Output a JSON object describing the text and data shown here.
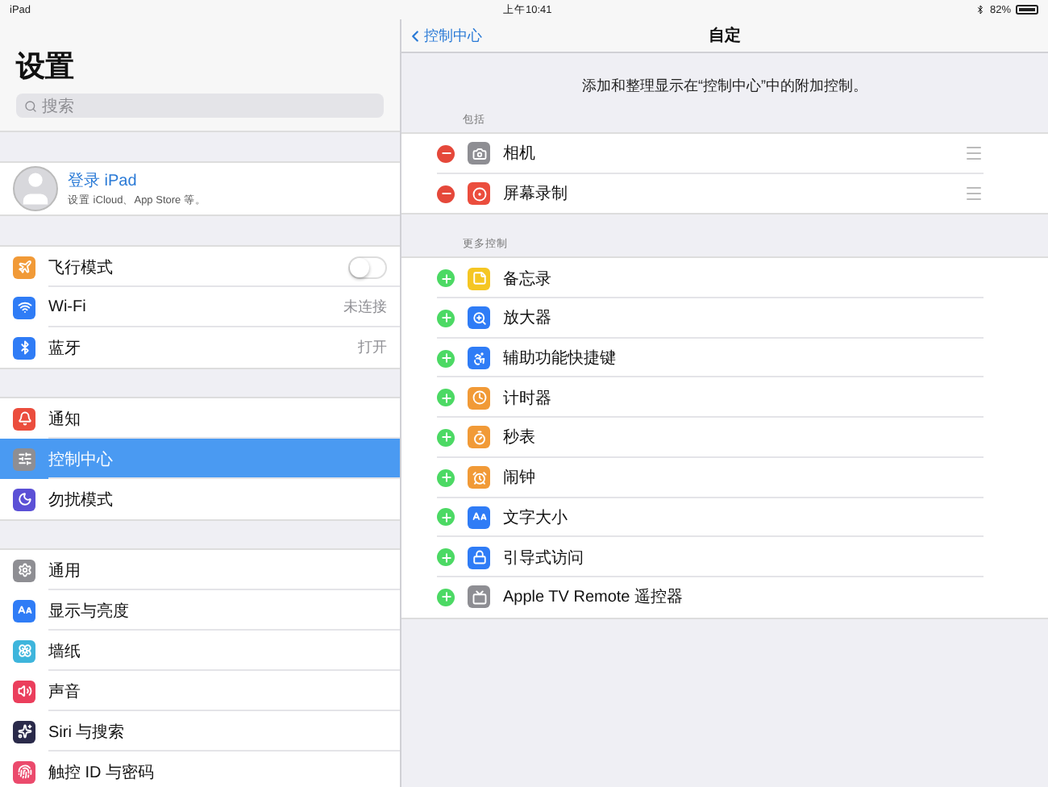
{
  "status_bar": {
    "device": "iPad",
    "time": "上午10:41",
    "battery": "82%"
  },
  "sidebar": {
    "title": "设置",
    "search": {
      "placeholder": "搜索"
    },
    "account": {
      "name": "登录 iPad",
      "subtitle": "设置 iCloud、App Store 等。"
    },
    "groups": [
      {
        "items": [
          {
            "label": "飞行模式",
            "kind": "toggle",
            "on": false,
            "color": "#f19a37",
            "selected": false
          },
          {
            "label": "Wi-Fi",
            "kind": "value",
            "value": "未连接",
            "color": "#2f7cf6",
            "selected": false
          },
          {
            "label": "蓝牙",
            "kind": "value",
            "value": "打开",
            "color": "#2f7cf6",
            "selected": false
          }
        ]
      },
      {
        "items": [
          {
            "label": "通知",
            "kind": "plain",
            "color": "#eb4d3d",
            "selected": false
          },
          {
            "label": "控制中心",
            "kind": "plain",
            "color": "#8e8e93",
            "selected": true
          },
          {
            "label": "勿扰模式",
            "kind": "plain",
            "color": "#5b50d6",
            "selected": false
          }
        ]
      },
      {
        "items": [
          {
            "label": "通用",
            "kind": "plain",
            "color": "#8e8e93",
            "selected": false
          },
          {
            "label": "显示与亮度",
            "kind": "plain",
            "color": "#2f7cf6",
            "selected": false
          },
          {
            "label": "墙纸",
            "kind": "plain",
            "color": "#3eb5dc",
            "selected": false
          },
          {
            "label": "声音",
            "kind": "plain",
            "color": "#eb3e5c",
            "selected": false
          },
          {
            "label": "Siri 与搜索",
            "kind": "plain",
            "color": "#2a2a4a",
            "selected": false
          },
          {
            "label": "触控 ID 与密码",
            "kind": "plain",
            "color": "#eb4a6c",
            "selected": false
          }
        ]
      }
    ]
  },
  "detail": {
    "back": "控制中心",
    "title": "自定",
    "description": "添加和整理显示在“控制中心”中的附加控制。",
    "sections": [
      {
        "header": "包括",
        "kind": "included",
        "items": [
          {
            "label": "相机",
            "color": "#8e8e93"
          },
          {
            "label": "屏幕录制",
            "color": "#eb4d3d"
          }
        ]
      },
      {
        "header": "更多控制",
        "kind": "more",
        "items": [
          {
            "label": "备忘录",
            "color": "#f5c623"
          },
          {
            "label": "放大器",
            "color": "#2f7cf6"
          },
          {
            "label": "辅助功能快捷键",
            "color": "#2f7cf6"
          },
          {
            "label": "计时器",
            "color": "#f19a37"
          },
          {
            "label": "秒表",
            "color": "#f19a37"
          },
          {
            "label": "闹钟",
            "color": "#f19a37"
          },
          {
            "label": "文字大小",
            "color": "#2f7cf6"
          },
          {
            "label": "引导式访问",
            "color": "#2f7cf6"
          },
          {
            "label": "Apple TV Remote 遥控器",
            "color": "#8e8e93"
          }
        ]
      }
    ]
  }
}
